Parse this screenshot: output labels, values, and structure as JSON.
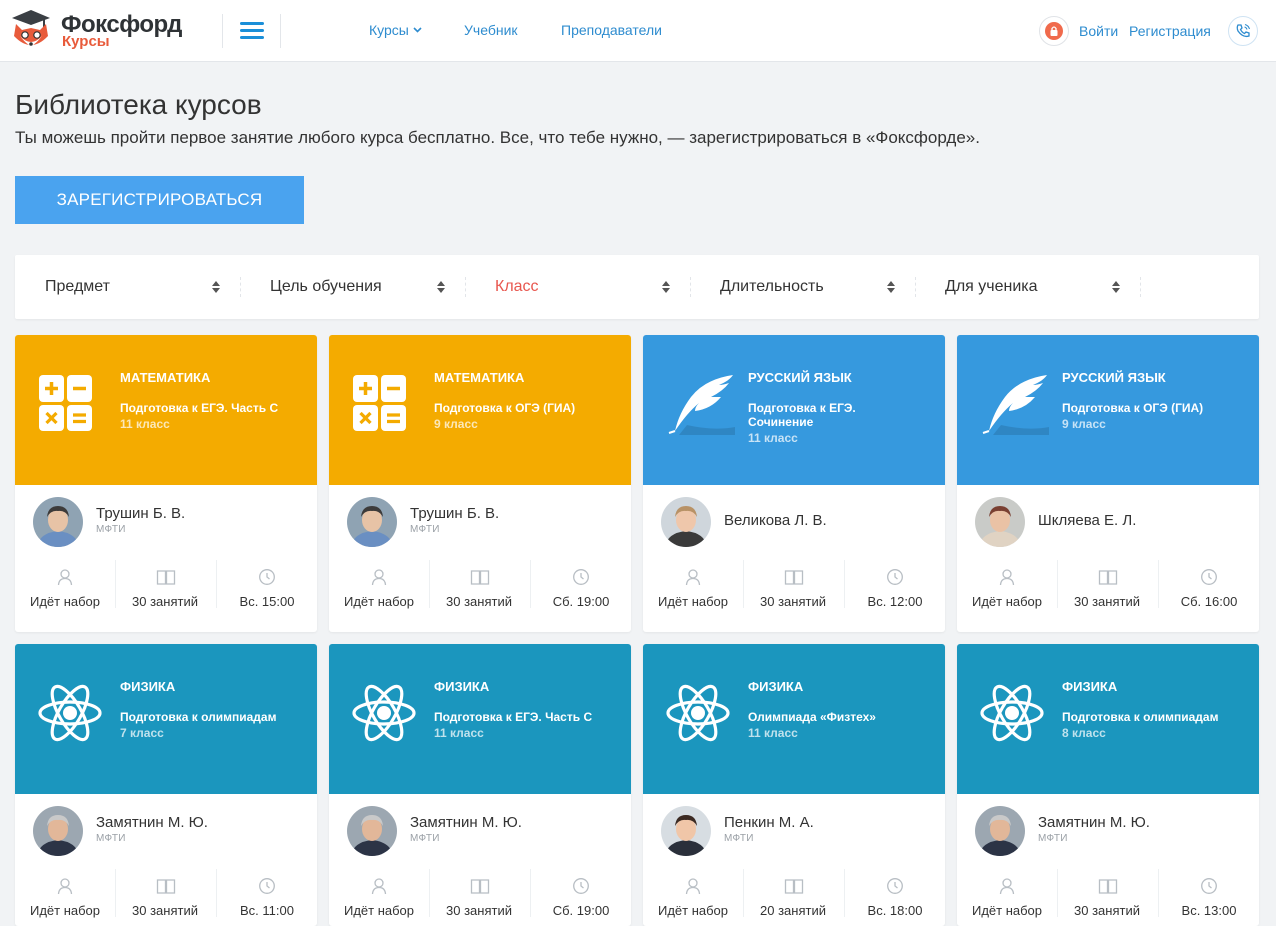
{
  "header": {
    "logo_name": "Фоксфорд",
    "logo_sub": "Курсы",
    "nav": [
      {
        "label": "Курсы"
      },
      {
        "label": "Учебник"
      },
      {
        "label": "Преподаватели"
      }
    ],
    "login": "Войти",
    "register": "Регистрация"
  },
  "intro": {
    "title": "Библиотека курсов",
    "subtitle": "Ты можешь пройти первое занятие любого курса бесплатно. Все, что тебе нужно, — зарегистрироваться в «Фоксфорде».",
    "register_button": "ЗАРЕГИСТРИРОВАТЬСЯ"
  },
  "filters": [
    {
      "label": "Предмет",
      "color": "#333333"
    },
    {
      "label": "Цель обучения",
      "color": "#333333"
    },
    {
      "label": "Класс",
      "color": "#e8574f"
    },
    {
      "label": "Длительность",
      "color": "#333333"
    },
    {
      "label": "Для ученика",
      "color": "#333333"
    }
  ],
  "colors": {
    "math": "#f4ab00",
    "russian": "#3699de",
    "physics": "#1b96be",
    "accent": "#4aa3ef",
    "link": "#2e8ccf"
  },
  "cards": [
    {
      "subject": "МАТЕМАТИКА",
      "course": "Подготовка к ЕГЭ. Часть С",
      "grade": "11 класс",
      "icon": "calculator-icon",
      "teacher": "Трушин Б. В.",
      "org": "МФТИ",
      "status": "Идёт набор",
      "lessons": "30 занятий",
      "time": "Вс. 15:00"
    },
    {
      "subject": "МАТЕМАТИКА",
      "course": "Подготовка к ОГЭ (ГИА)",
      "grade": "9 класс",
      "icon": "calculator-icon",
      "teacher": "Трушин Б. В.",
      "org": "МФТИ",
      "status": "Идёт набор",
      "lessons": "30 занятий",
      "time": "Сб. 19:00"
    },
    {
      "subject": "РУССКИЙ ЯЗЫК",
      "course": "Подготовка к ЕГЭ. Сочинение",
      "grade": "11 класс",
      "icon": "feather-icon",
      "teacher": "Великова Л. В.",
      "org": "",
      "status": "Идёт набор",
      "lessons": "30 занятий",
      "time": "Вс. 12:00"
    },
    {
      "subject": "РУССКИЙ ЯЗЫК",
      "course": "Подготовка к ОГЭ (ГИА)",
      "grade": "9 класс",
      "icon": "feather-icon",
      "teacher": "Шкляева Е. Л.",
      "org": "",
      "status": "Идёт набор",
      "lessons": "30 занятий",
      "time": "Сб. 16:00"
    },
    {
      "subject": "ФИЗИКА",
      "course": "Подготовка к олимпиадам",
      "grade": "7 класс",
      "icon": "atom-icon",
      "teacher": "Замятнин М. Ю.",
      "org": "МФТИ",
      "status": "Идёт набор",
      "lessons": "30 занятий",
      "time": "Вс. 11:00"
    },
    {
      "subject": "ФИЗИКА",
      "course": "Подготовка к ЕГЭ. Часть С",
      "grade": "11 класс",
      "icon": "atom-icon",
      "teacher": "Замятнин М. Ю.",
      "org": "МФТИ",
      "status": "Идёт набор",
      "lessons": "30 занятий",
      "time": "Сб. 19:00"
    },
    {
      "subject": "ФИЗИКА",
      "course": "Олимпиада «Физтех»",
      "grade": "11 класс",
      "icon": "atom-icon",
      "teacher": "Пенкин М. А.",
      "org": "МФТИ",
      "status": "Идёт набор",
      "lessons": "20 занятий",
      "time": "Вс. 18:00"
    },
    {
      "subject": "ФИЗИКА",
      "course": "Подготовка к олимпиадам",
      "grade": "8 класс",
      "icon": "atom-icon",
      "teacher": "Замятнин М. Ю.",
      "org": "МФТИ",
      "status": "Идёт набор",
      "lessons": "30 занятий",
      "time": "Вс. 13:00"
    }
  ]
}
